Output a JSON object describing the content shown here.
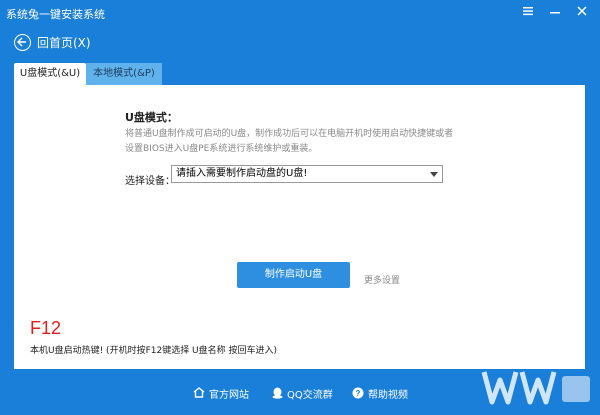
{
  "window": {
    "title": "系统兔一键安装系统",
    "controls": [
      "menu-icon",
      "minimize-icon",
      "close-icon"
    ]
  },
  "nav": {
    "back_label": "回首页(X)"
  },
  "tabs": [
    {
      "label": "U盘模式(&U)",
      "active": true
    },
    {
      "label": "本地模式(&P)",
      "active": false
    }
  ],
  "panel": {
    "mode_title": "U盘模式：",
    "mode_desc": "将普通U盘制作成可启动的U盘，制作成功后可以在电脑开机时使用启动快捷键或者设置BIOS进入U盘PE系统进行系统维护或重装。",
    "device_label": "选择设备：",
    "device_value": "请插入需要制作启动盘的U盘!",
    "make_button": "制作启动U盘",
    "more_settings": "更多设置",
    "hotkey": "F12",
    "hotkey_desc": "本机U盘启动热键! (开机时按F12键选择 U盘名称 按回车进入)"
  },
  "footer": {
    "links": [
      "官方网站",
      "QQ交流群",
      "帮助视频"
    ]
  },
  "colors": {
    "brand_blue": "#1a7fd9",
    "button_blue": "#2e8fe0",
    "hotkey_red": "#e02020"
  }
}
